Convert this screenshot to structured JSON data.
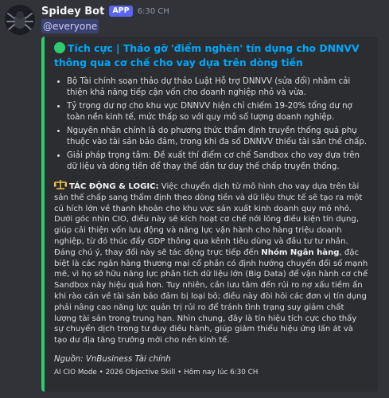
{
  "message": {
    "author": "Spidey Bot",
    "badge": "APP",
    "time": "6:30 CH",
    "mention": "@everyone"
  },
  "embed": {
    "accent": "#2ecc71",
    "title": "Tích cực | Tháo gỡ 'điểm nghẽn' tín dụng cho DNNVV thông qua cơ chế cho vay dựa trên dòng tiền",
    "bullets": [
      "Bộ Tài chính soạn thảo dự thảo Luật Hỗ trợ DNNVV (sửa đổi) nhằm cải thiện khả năng tiếp cận vốn cho doanh nghiệp nhỏ và vừa.",
      "Tỷ trọng dư nợ cho khu vực DNNVV hiện chỉ chiếm 19-20% tổng dư nợ toàn nền kinh tế, mức thấp so với quy mô số lượng doanh nghiệp.",
      "Nguyên nhân chính là do phương thức thẩm định truyền thống quá phụ thuộc vào tài sản bảo đảm, trong khi đa số DNNVV thiếu tài sản thế chấp.",
      "Giải pháp trọng tâm: Đề xuất thí điểm cơ chế Sandbox cho vay dựa trên dữ liệu và dòng tiền để thay thế dần tư duy thế chấp truyền thống."
    ],
    "impact": {
      "label": "TÁC ĐỘNG & LOGIC:",
      "text_1": " Việc chuyển dịch từ mô hình cho vay dựa trên tài sản thế chấp sang thẩm định theo dòng tiền và dữ liệu thực tế sẽ tạo ra một cú hích lớn về thanh khoản cho khu vực sản xuất kinh doanh quy mô nhỏ. Dưới góc nhìn CIO, điều này sẽ kích hoạt cơ chế nới lỏng điều kiện tín dụng, giúp cải thiện vốn lưu động và năng lực vận hành cho hàng triệu doanh nghiệp, từ đó thúc đẩy GDP thông qua kênh tiêu dùng và đầu tư tư nhân. Đáng chú ý, thay đổi này sẽ tác động trực tiếp đến ",
      "bold_2": "Nhóm Ngân hàng",
      "text_2": ", đặc biệt là các ngân hàng thương mại cổ phần có định hướng chuyển đổi số mạnh mẽ, vì họ sở hữu năng lực phân tích dữ liệu lớn (Big Data) để vận hành cơ chế Sandbox này hiệu quả hơn. Tuy nhiên, cần lưu tâm đến rủi ro nợ xấu tiềm ẩn khi rào cản về tài sản bảo đảm bị loại bỏ; điều này đòi hỏi các đơn vị tín dụng phải nâng cao năng lực quản trị rủi ro để tránh tình trạng suy giảm chất lượng tài sản trong trung hạn. Nhìn chung, đây là tín hiệu tích cực cho thấy sự chuyển dịch trong tư duy điều hành, giúp giảm thiểu hiệu ứng lấn át và tạo dư địa tăng trưởng mới cho nền kinh tế."
    },
    "source": "Nguồn: VnBusiness Tài chính",
    "footer": "AI CIO Mode • 2026 Objective Skill • Hôm nay lúc 6:30 CH"
  }
}
